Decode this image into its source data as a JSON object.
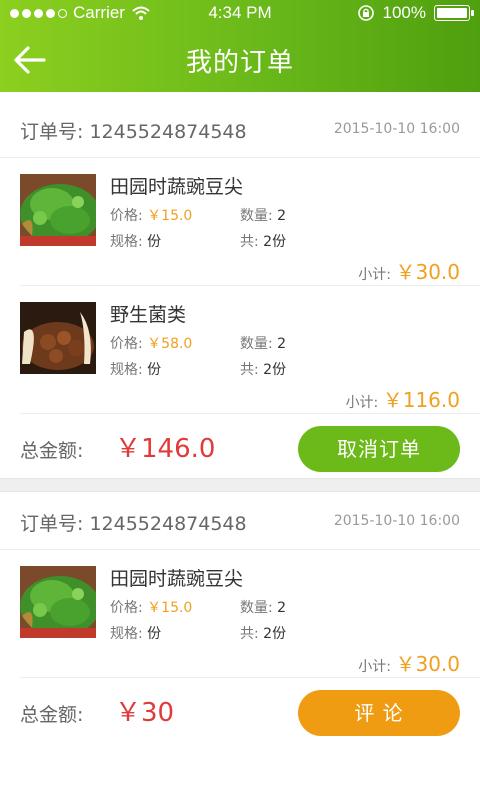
{
  "status_bar": {
    "carrier": "Carrier",
    "time": "4:34 PM",
    "battery": "100%",
    "battery_level": 1.0
  },
  "nav": {
    "title": "我的订单",
    "back_icon": "arrow-left-icon"
  },
  "orders": [
    {
      "order_no_label": "订单号:",
      "order_no": "1245524874548",
      "date": "2015-10-10 16:00",
      "items": [
        {
          "name": "田园时蔬豌豆尖",
          "price_label": "价格:",
          "price": "￥15.0",
          "qty_label": "数量:",
          "qty": "2",
          "spec_label": "规格:",
          "spec": "份",
          "total_qty_label": "共:",
          "total_qty": "2份",
          "subtotal_label": "小计:",
          "subtotal": "￥30.0"
        },
        {
          "name": "野生菌类",
          "price_label": "价格:",
          "price": "￥58.0",
          "qty_label": "数量:",
          "qty": "2",
          "spec_label": "规格:",
          "spec": "份",
          "total_qty_label": "共:",
          "total_qty": "2份",
          "subtotal_label": "小计:",
          "subtotal": "￥116.0"
        }
      ],
      "total_label": "总金额:",
      "total": "￥146.0",
      "action_label": "取消订单"
    },
    {
      "order_no_label": "订单号:",
      "order_no": "1245524874548",
      "date": "2015-10-10 16:00",
      "items": [
        {
          "name": "田园时蔬豌豆尖",
          "price_label": "价格:",
          "price": "￥15.0",
          "qty_label": "数量:",
          "qty": "2",
          "spec_label": "规格:",
          "spec": "份",
          "total_qty_label": "共:",
          "total_qty": "2份",
          "subtotal_label": "小计:",
          "subtotal": "￥30.0"
        }
      ],
      "total_label": "总金额:",
      "total": "￥30",
      "action_label": "评 论"
    }
  ],
  "colors": {
    "header_green": "#6cb91a",
    "price_orange": "#f0a020",
    "total_red": "#e03a3a",
    "cancel_button": "#6cb91a",
    "review_button": "#ef9c12"
  }
}
